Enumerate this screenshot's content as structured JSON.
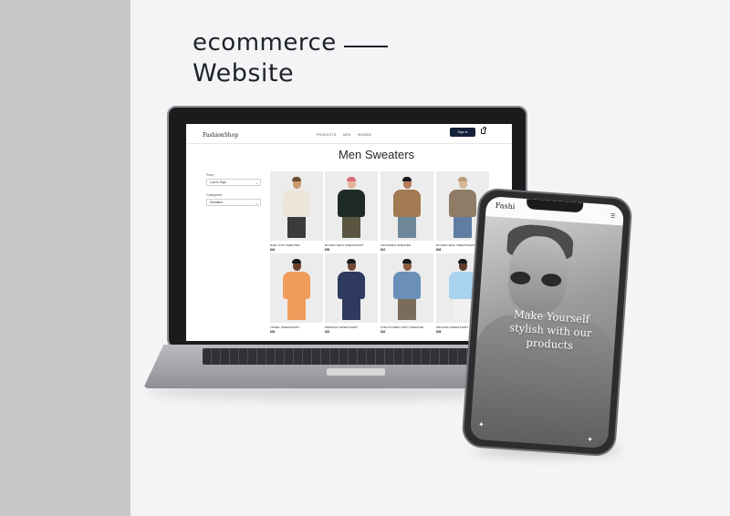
{
  "headline": {
    "line1": "ecommerce",
    "line2": "Website"
  },
  "site": {
    "logo": "FashionShop",
    "nav": [
      "PRODUCTS",
      "MEN",
      "WOMEN"
    ],
    "signin_label": "Sign in",
    "page_title": "Men Sweaters",
    "filters": {
      "price_label": "Price",
      "price_value": "Low to High",
      "category_label": "Categories",
      "category_value": "Sweaters"
    },
    "products": [
      {
        "name": "DUEL KNIT SWEATER",
        "price": "$42",
        "shirt": "#ece6da",
        "legs": "#3b3b3b",
        "skin": "#c79a72",
        "hair": "#6b4e2e"
      },
      {
        "name": "ROUND NECK SWEATSHIRT",
        "price": "$55",
        "shirt": "#1e2b25",
        "legs": "#5b5440",
        "skin": "#e2b59b",
        "hair": "#d86b7b"
      },
      {
        "name": "TEXTURED SWEATER",
        "price": "$22",
        "shirt": "#a37b52",
        "legs": "#6e8799",
        "skin": "#b37e5a",
        "hair": "#1a1a1a"
      },
      {
        "name": "ROUND NECK SWEATSHIRT",
        "price": "$48",
        "shirt": "#8f7c66",
        "legs": "#5f7da1",
        "skin": "#d9b79a",
        "hair": "#b99a7a"
      },
      {
        "name": "TOWEL SWEATSHIRT",
        "price": "$39",
        "shirt": "#ef9c5c",
        "legs": "#ef9c5c",
        "skin": "#6b4028",
        "hair": "#1a1a1a"
      },
      {
        "name": "PREMIUM SWEATSHIRT",
        "price": "$32",
        "shirt": "#2e3a5e",
        "legs": "#2e3a5e",
        "skin": "#6e4a34",
        "hair": "#1a1a1a"
      },
      {
        "name": "STRUCTURED SOFT SWEATER",
        "price": "$42",
        "shirt": "#6a8fb8",
        "legs": "#7a6c5a",
        "skin": "#8a5c40",
        "hair": "#1a1a1a"
      },
      {
        "name": "PRINTED SWEATSHIRT",
        "price": "$38",
        "shirt": "#a9d3ef",
        "legs": "#f0f0f0",
        "skin": "#5a3a28",
        "hair": "#1a1a1a"
      }
    ]
  },
  "phone": {
    "logo": "Fashi",
    "tagline": "Make Yourself stylish with our products"
  }
}
